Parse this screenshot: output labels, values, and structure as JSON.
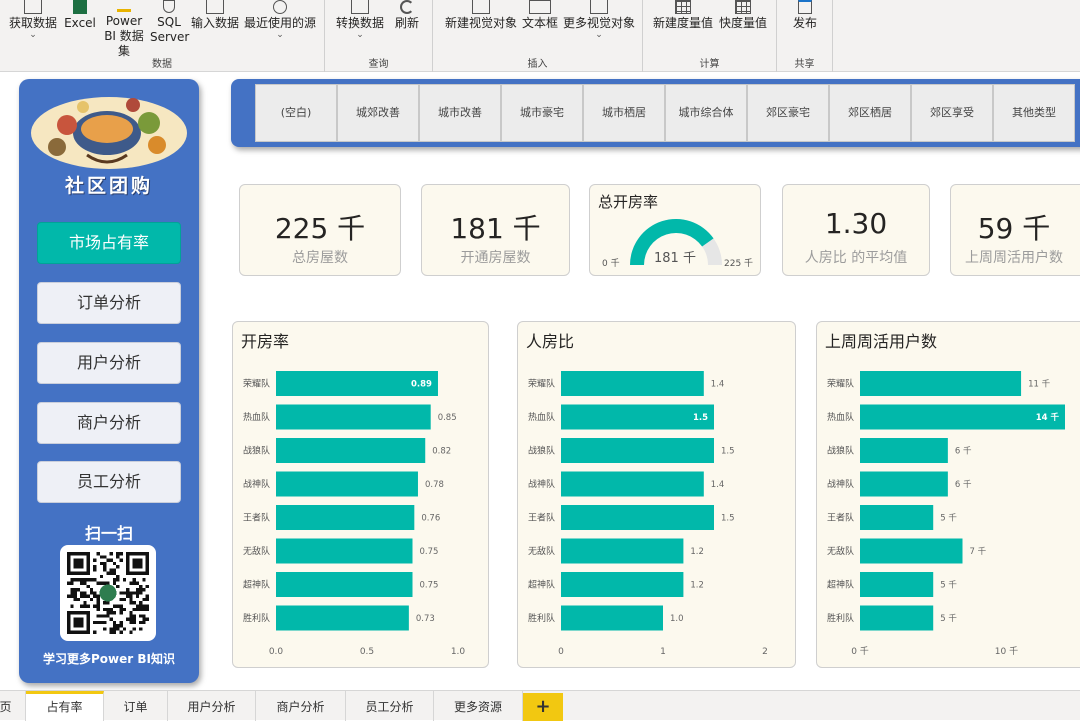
{
  "ribbon": {
    "groups": [
      {
        "name": "数据",
        "buttons": [
          {
            "label": "获取数据",
            "chevron": true,
            "icon": "table-icon"
          },
          {
            "label": "Excel",
            "icon": "excel-icon"
          },
          {
            "label": "Power BI 数据集",
            "icon": "powerbi-dataset-icon"
          },
          {
            "label": "SQL Server",
            "icon": "sql-server-icon"
          },
          {
            "label": "输入数据",
            "icon": "enter-data-icon"
          },
          {
            "label": "最近使用的源",
            "chevron": true,
            "icon": "recent-sources-icon"
          }
        ]
      },
      {
        "name": "查询",
        "buttons": [
          {
            "label": "转换数据",
            "chevron": true,
            "icon": "transform-icon"
          },
          {
            "label": "刷新",
            "icon": "refresh-icon"
          }
        ]
      },
      {
        "name": "插入",
        "buttons": [
          {
            "label": "新建视觉对象",
            "icon": "new-visual-icon"
          },
          {
            "label": "文本框",
            "icon": "textbox-icon"
          },
          {
            "label": "更多视觉对象",
            "chevron": true,
            "icon": "more-visuals-icon"
          }
        ]
      },
      {
        "name": "计算",
        "buttons": [
          {
            "label": "新建度量值",
            "icon": "calculator-icon"
          },
          {
            "label": "快度量值",
            "icon": "calculator-icon"
          }
        ]
      },
      {
        "name": "共享",
        "buttons": [
          {
            "label": "发布",
            "icon": "publish-icon"
          }
        ]
      }
    ]
  },
  "nav": {
    "logo_text": "社区团购",
    "items": [
      "市场占有率",
      "订单分析",
      "用户分析",
      "商户分析",
      "员工分析"
    ],
    "active_index": 0,
    "scan_title": "扫一扫",
    "learn_text": "学习更多Power BI知识"
  },
  "slicer": {
    "items": [
      "(空白)",
      "城郊改善",
      "城市改善",
      "城市豪宅",
      "城市栖居",
      "城市综合体",
      "郊区豪宅",
      "郊区栖居",
      "郊区享受",
      "其他类型"
    ]
  },
  "kpis": {
    "total_houses": {
      "value": "225 千",
      "label": "总房屋数"
    },
    "opened_houses": {
      "value": "181 千",
      "label": "开通房屋数"
    },
    "gauge": {
      "title": "总开房率",
      "value": "181 千",
      "min": "0 千",
      "max": "225 千",
      "fill_fraction": 0.804
    },
    "person_house_ratio": {
      "value": "1.30",
      "label": "人房比 的平均值"
    },
    "weekly_active_users": {
      "value": "59 千",
      "label": "上周周活用户数"
    }
  },
  "colors": {
    "bar": "#01b8aa",
    "panel": "#4472c4",
    "card_bg": "#fcf9ee",
    "tab_accent": "#f2c811"
  },
  "chart_data": [
    {
      "type": "bar",
      "orientation": "horizontal",
      "title": "开房率",
      "categories": [
        "荣耀队",
        "热血队",
        "战狼队",
        "战神队",
        "王者队",
        "无敌队",
        "超神队",
        "胜利队"
      ],
      "values": [
        0.89,
        0.85,
        0.82,
        0.78,
        0.76,
        0.75,
        0.75,
        0.73
      ],
      "value_labels": [
        "0.89",
        "0.85",
        "0.82",
        "0.78",
        "0.76",
        "0.75",
        "0.75",
        "0.73"
      ],
      "xlim": [
        0,
        1.0
      ],
      "xticks": [
        "0.0",
        "0.5",
        "1.0"
      ]
    },
    {
      "type": "bar",
      "orientation": "horizontal",
      "title": "人房比",
      "categories": [
        "荣耀队",
        "热血队",
        "战狼队",
        "战神队",
        "王者队",
        "无敌队",
        "超神队",
        "胜利队"
      ],
      "values": [
        1.4,
        1.5,
        1.5,
        1.4,
        1.5,
        1.2,
        1.2,
        1.0
      ],
      "value_labels": [
        "1.4",
        "1.5",
        "1.5",
        "1.4",
        "1.5",
        "1.2",
        "1.2",
        "1.0"
      ],
      "xlim": [
        0,
        2
      ],
      "xticks": [
        "0",
        "1",
        "2"
      ]
    },
    {
      "type": "bar",
      "orientation": "horizontal",
      "title": "上周周活用户数",
      "categories": [
        "荣耀队",
        "热血队",
        "战狼队",
        "战神队",
        "王者队",
        "无敌队",
        "超神队",
        "胜利队"
      ],
      "values": [
        11,
        14,
        6,
        6,
        5,
        7,
        5,
        5
      ],
      "value_labels": [
        "11 千",
        "14 千",
        "6 千",
        "6 千",
        "5 千",
        "7 千",
        "5 千",
        "5 千"
      ],
      "xlim": [
        0,
        14
      ],
      "xticks": [
        "0 千",
        "10 千"
      ],
      "xtick_values": [
        0,
        10
      ]
    }
  ],
  "tabs": {
    "items": [
      "页",
      "占有率",
      "订单",
      "用户分析",
      "商户分析",
      "员工分析",
      "更多资源"
    ],
    "active_index": 1,
    "add_label": "+"
  }
}
